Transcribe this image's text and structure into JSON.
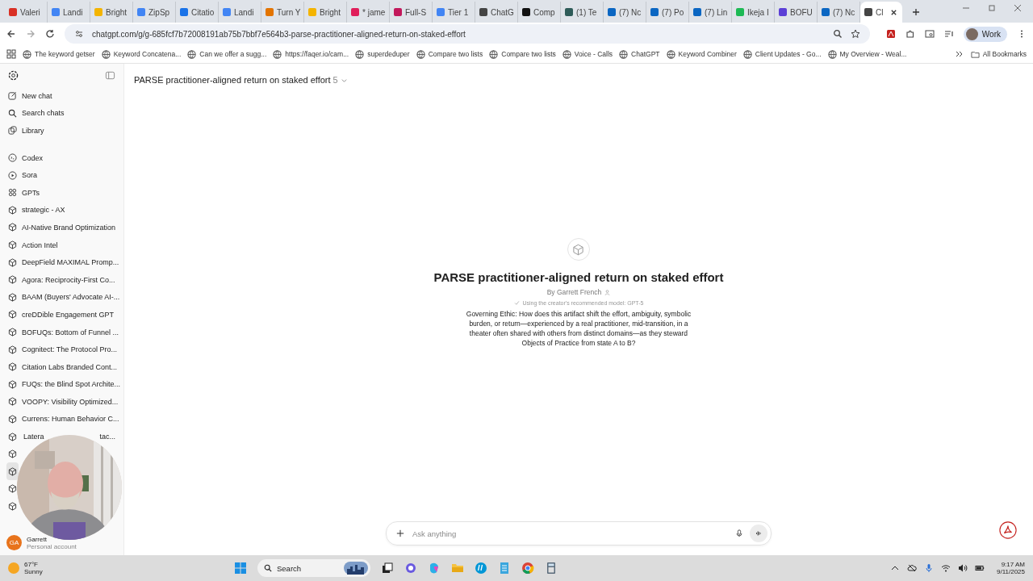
{
  "browser": {
    "tabs": [
      {
        "label": "Valeri",
        "color": "#d93025",
        "selected": false
      },
      {
        "label": "Landi",
        "color": "#4285f4",
        "selected": false
      },
      {
        "label": "Bright",
        "color": "#f4b400",
        "selected": false
      },
      {
        "label": "ZipSp",
        "color": "#4285f4",
        "selected": false
      },
      {
        "label": "Citatio",
        "color": "#1a73e8",
        "selected": false
      },
      {
        "label": "Landi",
        "color": "#4285f4",
        "selected": false
      },
      {
        "label": "Turn Y",
        "color": "#e37400",
        "selected": false
      },
      {
        "label": "Bright",
        "color": "#f4b400",
        "selected": false
      },
      {
        "label": "* jame",
        "color": "#e01e5a",
        "selected": false
      },
      {
        "label": "Full-S",
        "color": "#c2185b",
        "selected": false
      },
      {
        "label": "Tier 1",
        "color": "#4285f4",
        "selected": false
      },
      {
        "label": "ChatG",
        "color": "#444444",
        "selected": false
      },
      {
        "label": "Comp",
        "color": "#111111",
        "selected": false
      },
      {
        "label": "(1) Te",
        "color": "#2e5b58",
        "selected": false
      },
      {
        "label": "(7) Nc",
        "color": "#0a66c2",
        "selected": false
      },
      {
        "label": "(7) Po",
        "color": "#0a66c2",
        "selected": false
      },
      {
        "label": "(7) Lin",
        "color": "#0a66c2",
        "selected": false
      },
      {
        "label": "Ikeja I",
        "color": "#1db954",
        "selected": false
      },
      {
        "label": "BOFU",
        "color": "#5b3fd6",
        "selected": false
      },
      {
        "label": "(7) Nc",
        "color": "#0a66c2",
        "selected": false
      },
      {
        "label": "Cl",
        "color": "#444444",
        "selected": true
      }
    ],
    "url": "chatgpt.com/g/g-685fcf7b72008191ab75b7bbf7e564b3-parse-practitioner-aligned-return-on-staked-effort",
    "profile": "Work",
    "bookmarks": [
      "The keyword getser",
      "Keyword Concatena...",
      "Can we offer a sugg...",
      "https://faqer.io/cam...",
      "superdeduper",
      "Compare two lists",
      "Compare two lists",
      "Voice - Calls",
      "ChatGPT",
      "Keyword Combiner",
      "Client Updates - Go...",
      "My Overview - Weal..."
    ],
    "all_bookmarks": "All Bookmarks"
  },
  "sidebar": {
    "top": [
      {
        "label": "New chat",
        "kind": "edit"
      },
      {
        "label": "Search chats",
        "kind": "search"
      },
      {
        "label": "Library",
        "kind": "library"
      }
    ],
    "apps": [
      {
        "label": "Codex",
        "kind": "codex"
      },
      {
        "label": "Sora",
        "kind": "play"
      },
      {
        "label": "GPTs",
        "kind": "grid"
      }
    ],
    "gpts": [
      {
        "label": "strategic - AX",
        "selected": false
      },
      {
        "label": "AI-Native Brand Optimization",
        "selected": false
      },
      {
        "label": "Action Intel",
        "selected": false
      },
      {
        "label": "DeepField MAXIMAL Promp...",
        "selected": false
      },
      {
        "label": "Agora: Reciprocity-First Co...",
        "selected": false
      },
      {
        "label": "BAAM (Buyers' Advocate AI-...",
        "selected": false
      },
      {
        "label": "creDDible Engagement GPT",
        "selected": false
      },
      {
        "label": "BOFUQs: Bottom of Funnel ...",
        "selected": false
      },
      {
        "label": "Cognitect: The Protocol Pro...",
        "selected": false
      },
      {
        "label": "Citation Labs Branded Cont...",
        "selected": false
      },
      {
        "label": "FUQs: the Blind Spot Archite...",
        "selected": false
      },
      {
        "label": "VOOPY: Visibility Optimized...",
        "selected": false
      },
      {
        "label": "Currens: Human Behavior C...",
        "selected": false
      },
      {
        "label": "Latera",
        "tail": "tac...",
        "selected": false
      },
      {
        "selected": false
      },
      {
        "selected": true
      },
      {
        "selected": false
      },
      {
        "selected": false
      }
    ],
    "user": {
      "initials": "GA",
      "name": "Garrett",
      "plan": "Personal account"
    }
  },
  "header": {
    "title": "PARSE practitioner-aligned return on staked effort",
    "version": "5"
  },
  "gpt": {
    "title": "PARSE practitioner-aligned return on staked effort",
    "author": "By Garrett French",
    "model_note": "Using the creator's recommended model: GPT-5",
    "description": "Governing Ethic: How does this artifact shift the effort, ambiguity, symbolic burden, or return—experienced by a real practitioner, mid-transition, in a theater often shared with others from distinct domains—as they steward Objects of Practice from state A to B?"
  },
  "composer": {
    "placeholder": "Ask anything"
  },
  "taskbar": {
    "weather": {
      "temp": "67°F",
      "condition": "Sunny"
    },
    "search": "Search",
    "time": "9:17 AM",
    "date": "9/11/2025"
  }
}
